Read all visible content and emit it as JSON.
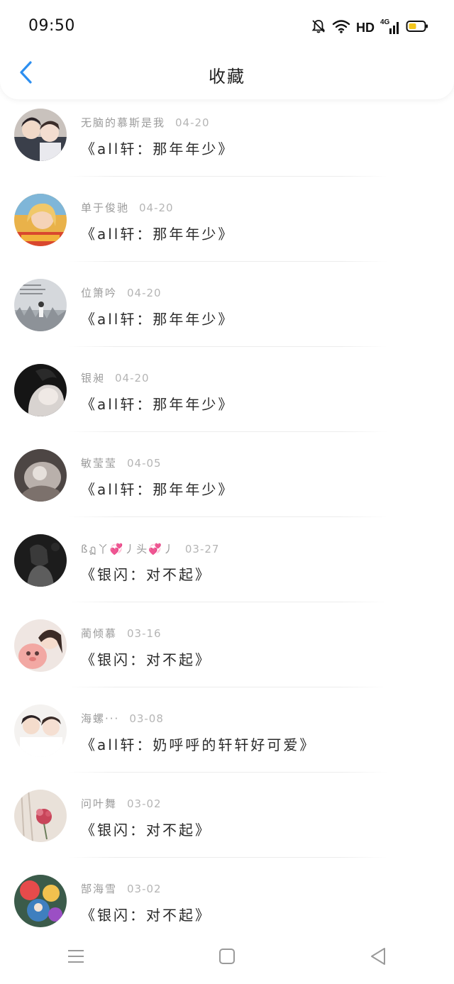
{
  "status_bar": {
    "time": "09:50",
    "network_label": "HD",
    "signal_label": "4G",
    "icons": [
      "bell-mute-icon",
      "wifi-icon",
      "signal-icon",
      "battery-icon"
    ],
    "battery_color": "#f3c61c"
  },
  "header": {
    "title": "收藏",
    "back_icon": "chevron-left-icon",
    "accent_color": "#2d8ff0"
  },
  "items": [
    {
      "author": "无脑的慕斯是我",
      "date": "04-20",
      "title": "《all轩：那年年少》"
    },
    {
      "author": "单于俊驰",
      "date": "04-20",
      "title": "《all轩：那年年少》"
    },
    {
      "author": "位箫吟",
      "date": "04-20",
      "title": "《all轩：那年年少》"
    },
    {
      "author": "银昶",
      "date": "04-20",
      "title": "《all轩：那年年少》"
    },
    {
      "author": "敏莹莹",
      "date": "04-05",
      "title": "《all轩：那年年少》"
    },
    {
      "author": "ßฏ丫💞丿头💞丿",
      "date": "03-27",
      "title": "《银闪：对不起》"
    },
    {
      "author": "蔺倾慕",
      "date": "03-16",
      "title": "《银闪：对不起》"
    },
    {
      "author": "海螺···",
      "date": "03-08",
      "title": "《all轩：奶呼呼的轩轩好可爱》"
    },
    {
      "author": "问叶舞",
      "date": "03-02",
      "title": "《银闪：对不起》"
    },
    {
      "author": "郜海雪",
      "date": "03-02",
      "title": "《银闪：对不起》"
    }
  ],
  "nav_bar": {
    "icons": [
      "menu-icon",
      "home-square-icon",
      "back-triangle-icon"
    ]
  }
}
